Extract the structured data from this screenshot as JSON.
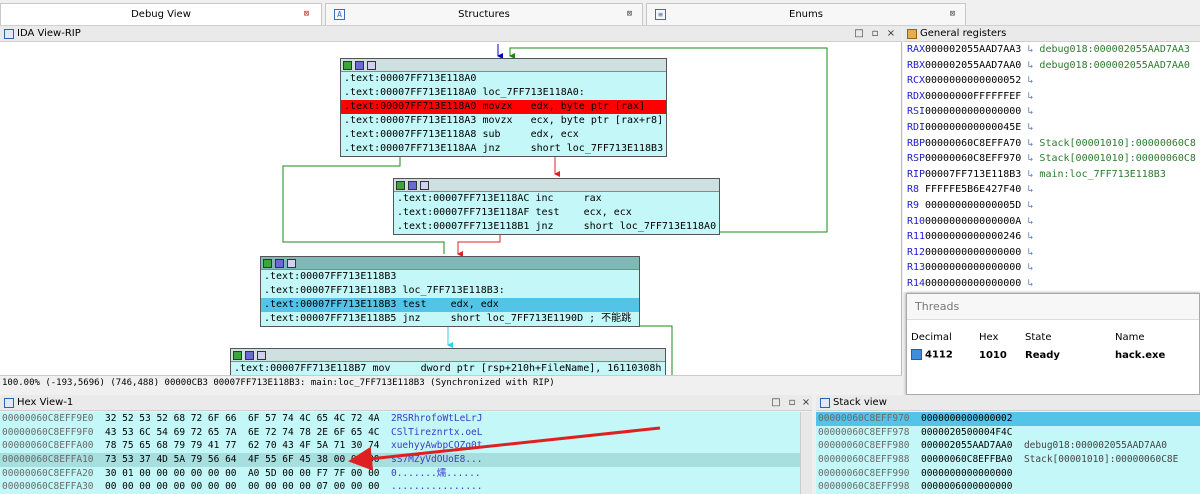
{
  "tabs": [
    {
      "label": "Debug View",
      "active": true
    },
    {
      "label": "Structures",
      "active": false
    },
    {
      "label": "Enums",
      "active": false
    }
  ],
  "ida_view": {
    "title": "IDA View-RIP",
    "nodes": [
      {
        "lines": [
          ".text:00007FF713E118A0",
          ".text:00007FF713E118A0 loc_7FF713E118A0:",
          ".text:00007FF713E118A0 movzx   edx, byte ptr [rax]",
          ".text:00007FF713E118A3 movzx   ecx, byte ptr [rax+r8]",
          ".text:00007FF713E118A8 sub     edx, ecx",
          ".text:00007FF713E118AA jnz     short loc_7FF713E118B3"
        ]
      },
      {
        "lines": [
          ".text:00007FF713E118AC inc     rax",
          ".text:00007FF713E118AF test    ecx, ecx",
          ".text:00007FF713E118B1 jnz     short loc_7FF713E118A0"
        ]
      },
      {
        "lines": [
          ".text:00007FF713E118B3",
          ".text:00007FF713E118B3 loc_7FF713E118B3:",
          ".text:00007FF713E118B3 test    edx, edx",
          ".text:00007FF713E118B5 jnz     short loc_7FF713E1190D ; 不能跳"
        ]
      },
      {
        "lines": [
          ".text:00007FF713E118B7 mov     dword ptr [rsp+210h+FileName], 16110308h"
        ]
      }
    ],
    "status": "100.00% (-193,5696) (746,488) 00000CB3 00007FF713E118B3: main:loc_7FF713E118B3 (Synchronized with RIP)"
  },
  "registers": {
    "title": "General registers",
    "rows": [
      {
        "name": "RAX",
        "value": "000002055AAD7AA3",
        "comment": "debug018:000002055AAD7AA3"
      },
      {
        "name": "RBX",
        "value": "000002055AAD7AA0",
        "comment": "debug018:000002055AAD7AA0"
      },
      {
        "name": "RCX",
        "value": "0000000000000052",
        "comment": ""
      },
      {
        "name": "RDX",
        "value": "00000000FFFFFFEF",
        "comment": ""
      },
      {
        "name": "RSI",
        "value": "0000000000000000",
        "comment": ""
      },
      {
        "name": "RDI",
        "value": "000000000000045E",
        "comment": ""
      },
      {
        "name": "RBP",
        "value": "00000060C8EFFA70",
        "comment": "Stack[00001010]:00000060C8"
      },
      {
        "name": "RSP",
        "value": "00000060C8EFF970",
        "comment": "Stack[00001010]:00000060C8"
      },
      {
        "name": "RIP",
        "value": "00007FF713E118B3",
        "comment": "main:loc_7FF713E118B3"
      },
      {
        "name": "R8",
        "value": "FFFFFE5B6E427F40",
        "comment": ""
      },
      {
        "name": "R9",
        "value": "000000000000005D",
        "comment": ""
      },
      {
        "name": "R10",
        "value": "000000000000000A",
        "comment": ""
      },
      {
        "name": "R11",
        "value": "0000000000000246",
        "comment": ""
      },
      {
        "name": "R12",
        "value": "0000000000000000",
        "comment": ""
      },
      {
        "name": "R13",
        "value": "0000000000000000",
        "comment": ""
      },
      {
        "name": "R14",
        "value": "0000000000000000",
        "comment": ""
      }
    ]
  },
  "threads": {
    "title": "Threads",
    "headers": [
      "Decimal",
      "Hex",
      "State",
      "Name"
    ],
    "rows": [
      {
        "decimal": "4112",
        "hex": "1010",
        "state": "Ready",
        "name": "hack.exe"
      }
    ]
  },
  "hex_view": {
    "title": "Hex View-1",
    "rows": [
      {
        "addr": "00000060C8EFF9E0",
        "bytes": "32 52 53 52 68 72 6F 66  6F 57 74 4C 65 4C 72 4A",
        "ascii": "2RSRhrofoWtLeLrJ"
      },
      {
        "addr": "00000060C8EFF9F0",
        "bytes": "43 53 6C 54 69 72 65 7A  6E 72 74 78 2E 6F 65 4C",
        "ascii": "CSlTireznrtx.oeL"
      },
      {
        "addr": "00000060C8EFFA00",
        "bytes": "78 75 65 68 79 79 41 77  62 70 43 4F 5A 71 30 74",
        "ascii": "xuehyyAwbpCOZq0t"
      },
      {
        "addr": "00000060C8EFFA10",
        "bytes": "73 53 37 4D 5A 79 56 64  4F 55 6F 45 38 00 00 00",
        "ascii": "sS7MZyVdOUoE8..."
      },
      {
        "addr": "00000060C8EFFA20",
        "bytes": "30 01 00 00 00 00 00 00  A0 5D 00 00 F7 7F 00 00",
        "ascii": "0.......燸......"
      },
      {
        "addr": "00000060C8EFFA30",
        "bytes": "00 00 00 00 00 00 00 00  00 00 00 00 07 00 00 00",
        "ascii": "................"
      }
    ]
  },
  "stack_view": {
    "title": "Stack view",
    "rows": [
      {
        "addr": "00000060C8EFF970",
        "value": "0000000000000002",
        "comment": ""
      },
      {
        "addr": "00000060C8EFF978",
        "value": "0000020500004F4C",
        "comment": ""
      },
      {
        "addr": "00000060C8EFF980",
        "value": "000002055AAD7AA0",
        "comment": "debug018:000002055AAD7AA0"
      },
      {
        "addr": "00000060C8EFF988",
        "value": "00000060C8EFFBA0",
        "comment": "Stack[00001010]:00000060C8E"
      },
      {
        "addr": "00000060C8EFF990",
        "value": "0000000000000000",
        "comment": ""
      },
      {
        "addr": "00000060C8EFF998",
        "value": "0000006000000000",
        "comment": ""
      }
    ]
  }
}
